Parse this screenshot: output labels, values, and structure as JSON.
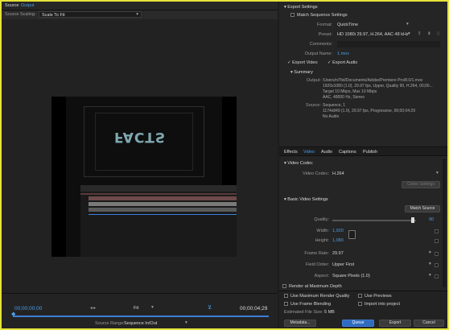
{
  "tabs": {
    "source": "Source",
    "output": "Output"
  },
  "source_scaling": {
    "label": "Source Scaling:",
    "value": "Scale To Fit"
  },
  "viewer": {
    "text": "FACTS"
  },
  "transport": {
    "timecode_start": "00;00;00;00",
    "fit": "Fit",
    "timecode_end": "00;00;04;29",
    "source_range_label": "Source Range:",
    "source_range_value": "Sequence In/Out"
  },
  "export_settings": {
    "title": "Export Settings",
    "match_sequence": "Match Sequence Settings",
    "format_label": "Format:",
    "format_value": "QuickTime",
    "preset_label": "Preset:",
    "preset_value": "HD 1080i 29.97, H.264, AAC 48 kHz",
    "comments_label": "Comments:",
    "output_name_label": "Output Name:",
    "output_name_value": "1.mov",
    "export_video": "Export Video",
    "export_audio": "Export Audio",
    "summary_title": "Summary",
    "output_label": "Output:",
    "output_line1": "/Users/ni?lol/Documents/Adobe/Premiere Pro/8.0/1.mov",
    "output_line2": "1920x1080 (1.0), 29.97 fps, Upper, Quality 90, H.264, 00;00...",
    "output_line3": "Target 10 Mbps, Max 10 Mbps",
    "output_line4": "AAC, 48000 Hz, Stereo",
    "source_label": "Source:",
    "source_line1": "Sequence, 1",
    "source_line2": "1174x849 (1.0), 29.97 fps, Progressive, 00;00;04;29",
    "source_line3": "No Audio"
  },
  "tabs2": [
    "Effects",
    "Video",
    "Audio",
    "Captions",
    "Publish"
  ],
  "video": {
    "codec_title": "Video Codec",
    "codec_label": "Video Codec:",
    "codec_value": "H.264",
    "codec_settings": "Codec Settings",
    "basic_title": "Basic Video Settings",
    "match_source": "Match Source",
    "quality_label": "Quality:",
    "quality_value": "90",
    "width_label": "Width:",
    "width_value": "1,920",
    "height_label": "Height:",
    "height_value": "1,080",
    "frame_rate_label": "Frame Rate:",
    "frame_rate_value": "29.97",
    "field_order_label": "Field Order:",
    "field_order_value": "Upper First",
    "aspect_label": "Aspect:",
    "aspect_value": "Square Pixels (1.0)",
    "render_max": "Render at Maximum Depth"
  },
  "bottom": {
    "use_max_render": "Use Maximum Render Quality",
    "use_previews": "Use Previews",
    "use_frame_blending": "Use Frame Blending",
    "import_into_project": "Import into project",
    "file_size_label": "Estimated File Size:",
    "file_size_value": "5 MB",
    "metadata": "Metadata...",
    "queue": "Queue",
    "export": "Export",
    "cancel": "Cancel"
  },
  "colors": {
    "accent": "#4a9ee8",
    "primary_button": "#2f6bbf",
    "frame_border": "#e6e23a"
  }
}
